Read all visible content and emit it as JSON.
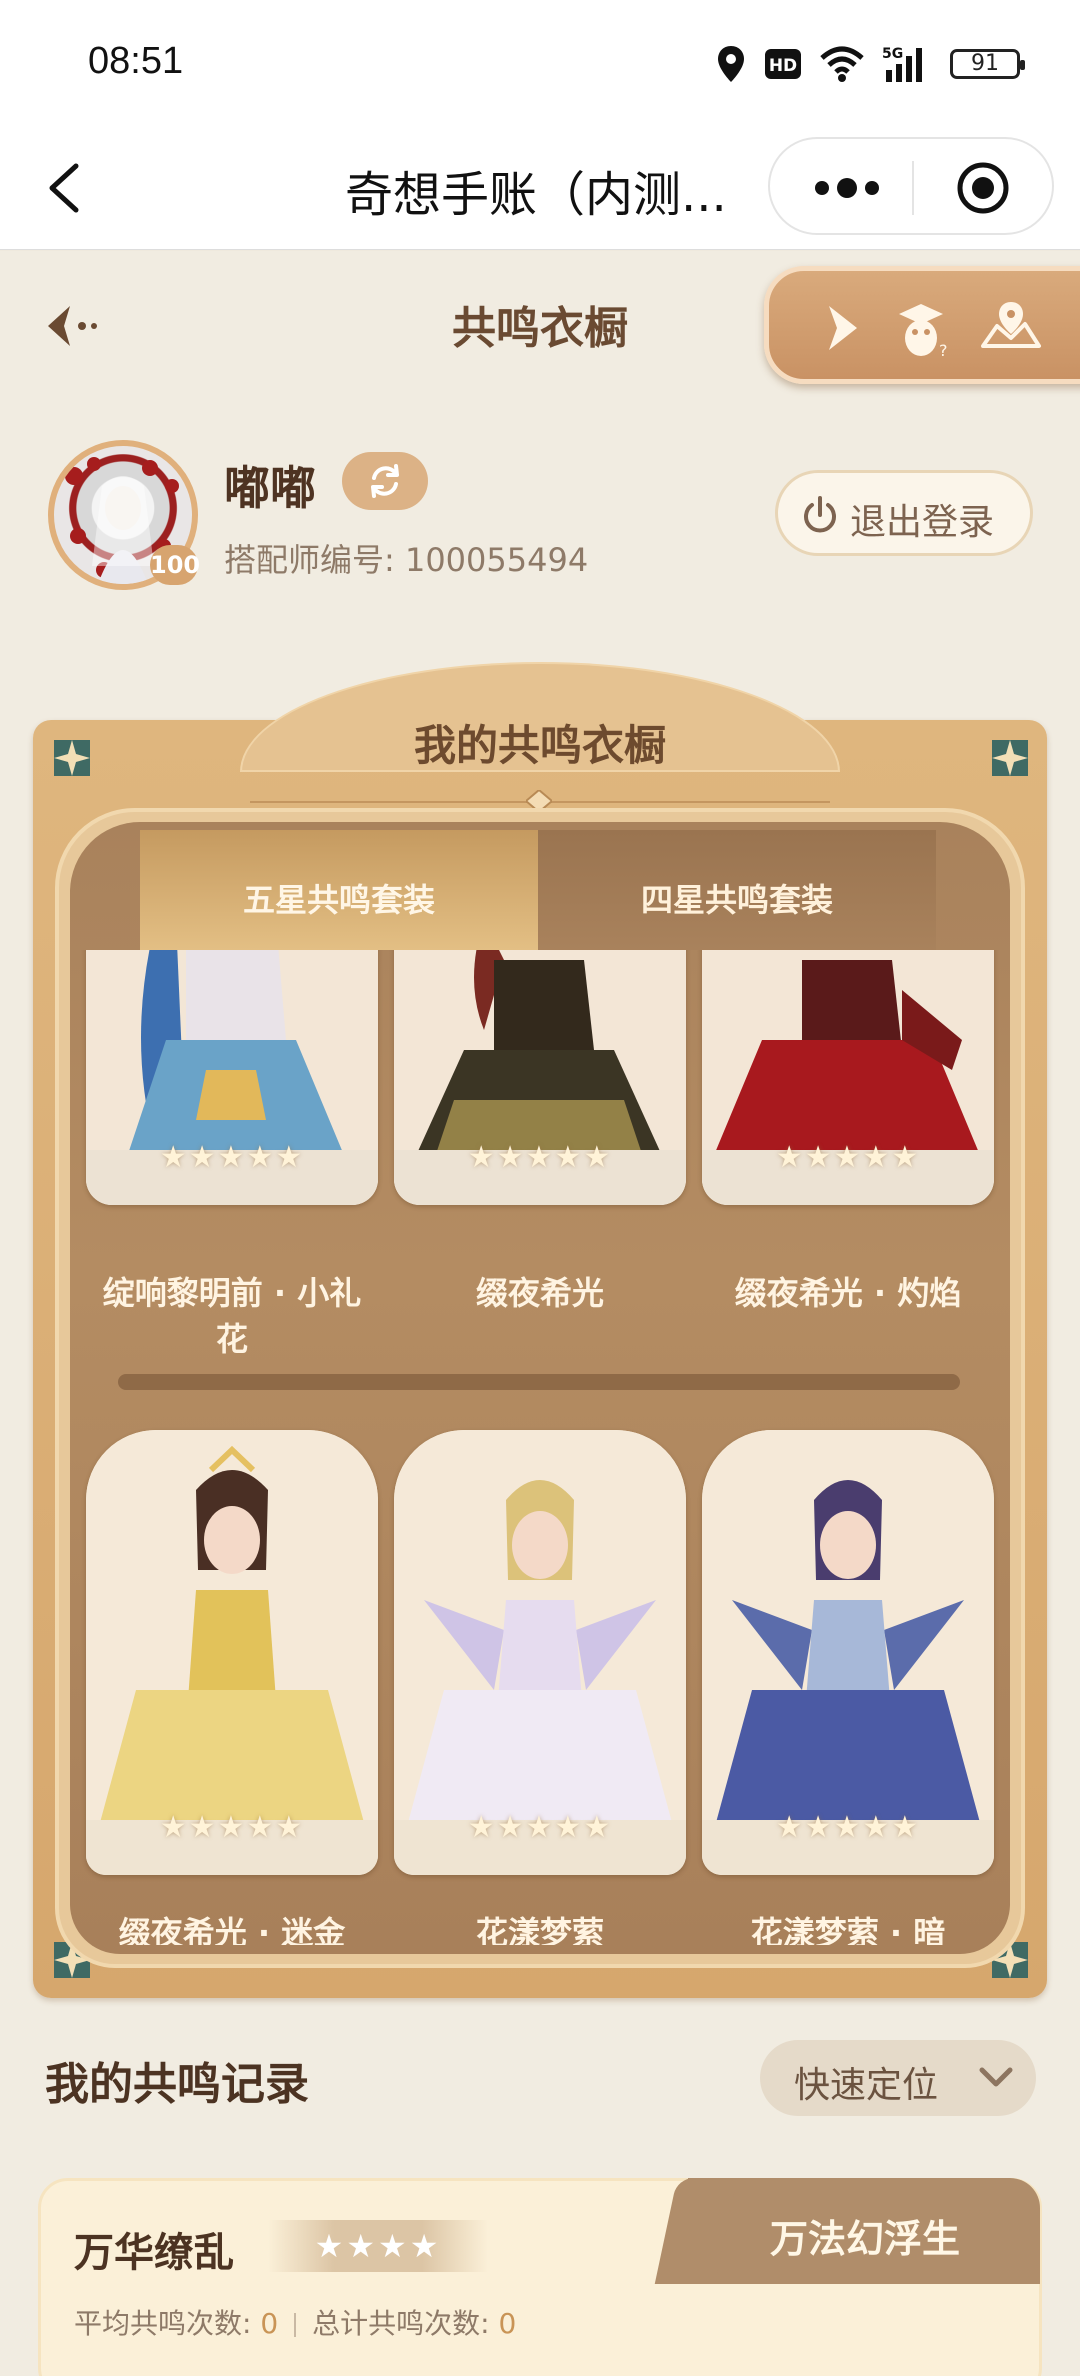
{
  "status_bar": {
    "time": "08:51",
    "network": "5G",
    "hd": "HD",
    "battery": "91"
  },
  "nav": {
    "title": "奇想手账（内测...",
    "back_icon": "chevron-left-icon",
    "more_icon": "more-dots-icon",
    "close_icon": "mini-program-target-icon"
  },
  "header": {
    "title": "共鸣衣橱"
  },
  "tools": [
    "play-arrow-icon",
    "penguin-guide-icon",
    "map-icon"
  ],
  "profile": {
    "name": "嘟嘟",
    "level": "100",
    "designer_id": "搭配师编号: 100055494",
    "logout_label": "退出登录"
  },
  "wardrobe": {
    "title": "我的共鸣衣橱",
    "tabs": [
      {
        "label": "五星共鸣套装",
        "active": true
      },
      {
        "label": "四星共鸣套装",
        "active": false
      }
    ],
    "row1": [
      {
        "name": "绽响黎明前 · 小礼\n花",
        "stars": "★★★★★",
        "color": "#3d7fb8"
      },
      {
        "name": "缀夜希光",
        "stars": "★★★★★",
        "color": "#2c2a22"
      },
      {
        "name": "缀夜希光 · 灼焰",
        "stars": "★★★★★",
        "color": "#a01a1a"
      }
    ],
    "row2": [
      {
        "name": "缀夜希光 · 迷金",
        "stars": "★★★★★",
        "color": "#e2c25a"
      },
      {
        "name": "花漾梦萦",
        "stars": "★★★★★",
        "color": "#d8c8e8"
      },
      {
        "name": "花漾梦萦 · 暗",
        "stars": "★★★★★",
        "color": "#4b5aa4"
      }
    ]
  },
  "records": {
    "title": "我的共鸣记录",
    "locate_label": "快速定位",
    "card": {
      "tab_label": "万法幻浮生",
      "name": "万华缭乱",
      "stars": "★★★★",
      "avg_label": "平均共鸣次数: ",
      "avg_value": "0",
      "total_label": "总计共鸣次数: ",
      "total_value": "0"
    }
  }
}
